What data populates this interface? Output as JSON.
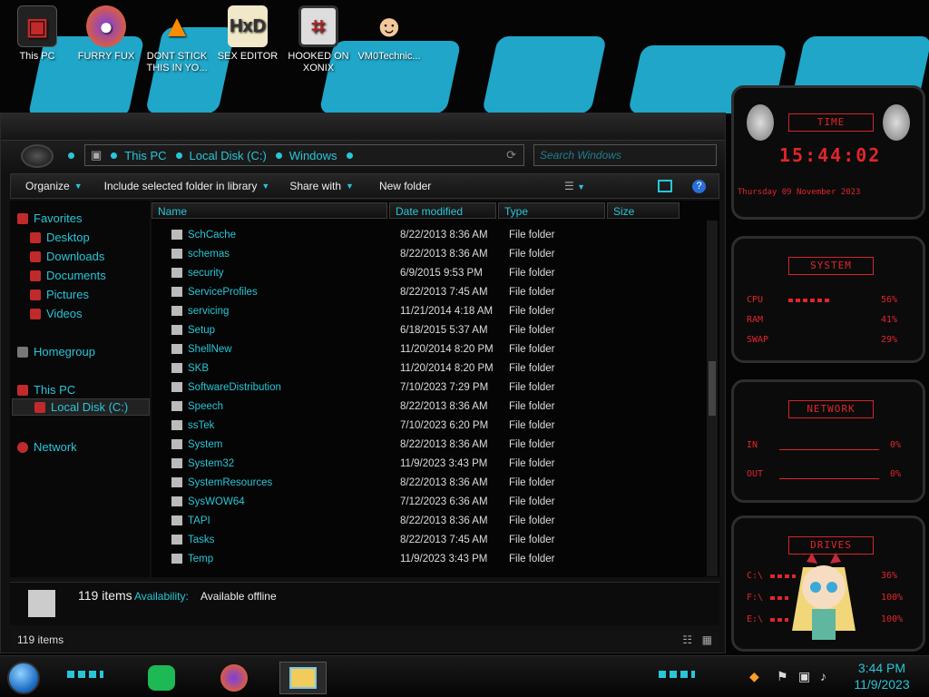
{
  "desktop": {
    "icons": [
      {
        "label": "This PC",
        "icon": "pc-icon"
      },
      {
        "label": "FURRY FUX",
        "icon": "firefox-icon"
      },
      {
        "label": "DONT STICK THIS IN YO...",
        "icon": "vlc-cone-icon"
      },
      {
        "label": "SEX EDITOR",
        "icon": "hxd-icon"
      },
      {
        "label": "HOOKED ON XONIX",
        "icon": "xonix-game-icon"
      },
      {
        "label": "VM0Technic...",
        "icon": "doctor-icon"
      }
    ]
  },
  "explorer": {
    "breadcrumb": [
      "This PC",
      "Local Disk (C:)",
      "Windows"
    ],
    "search_placeholder": "Search Windows",
    "toolbar": {
      "organize": "Organize",
      "include_library": "Include selected folder in library",
      "share_with": "Share with",
      "new_folder": "New folder"
    },
    "nav": {
      "favorites": "Favorites",
      "desktop": "Desktop",
      "downloads": "Downloads",
      "documents": "Documents",
      "pictures": "Pictures",
      "videos": "Videos",
      "homegroup": "Homegroup",
      "this_pc": "This PC",
      "local_disk": "Local Disk (C:)",
      "network": "Network"
    },
    "columns": {
      "name": "Name",
      "date": "Date modified",
      "type": "Type",
      "size": "Size"
    },
    "rows": [
      {
        "name": "SchCache",
        "date": "8/22/2013 8:36 AM",
        "type": "File folder"
      },
      {
        "name": "schemas",
        "date": "8/22/2013 8:36 AM",
        "type": "File folder"
      },
      {
        "name": "security",
        "date": "6/9/2015 9:53 PM",
        "type": "File folder"
      },
      {
        "name": "ServiceProfiles",
        "date": "8/22/2013 7:45 AM",
        "type": "File folder"
      },
      {
        "name": "servicing",
        "date": "11/21/2014 4:18 AM",
        "type": "File folder"
      },
      {
        "name": "Setup",
        "date": "6/18/2015 5:37 AM",
        "type": "File folder"
      },
      {
        "name": "ShellNew",
        "date": "11/20/2014 8:20 PM",
        "type": "File folder"
      },
      {
        "name": "SKB",
        "date": "11/20/2014 8:20 PM",
        "type": "File folder"
      },
      {
        "name": "SoftwareDistribution",
        "date": "7/10/2023 7:29 PM",
        "type": "File folder"
      },
      {
        "name": "Speech",
        "date": "8/22/2013 8:36 AM",
        "type": "File folder"
      },
      {
        "name": "ssTek",
        "date": "7/10/2023 6:20 PM",
        "type": "File folder"
      },
      {
        "name": "System",
        "date": "8/22/2013 8:36 AM",
        "type": "File folder"
      },
      {
        "name": "System32",
        "date": "11/9/2023 3:43 PM",
        "type": "File folder"
      },
      {
        "name": "SystemResources",
        "date": "8/22/2013 8:36 AM",
        "type": "File folder"
      },
      {
        "name": "SysWOW64",
        "date": "7/12/2023 6:36 AM",
        "type": "File folder"
      },
      {
        "name": "TAPI",
        "date": "8/22/2013 8:36 AM",
        "type": "File folder"
      },
      {
        "name": "Tasks",
        "date": "8/22/2013 7:45 AM",
        "type": "File folder"
      },
      {
        "name": "Temp",
        "date": "11/9/2023 3:43 PM",
        "type": "File folder"
      }
    ],
    "details": {
      "count": "119 items",
      "availability_label": "Availability:",
      "availability_value": "Available offline"
    },
    "status": "119 items"
  },
  "gadgets": {
    "time": {
      "title": "TIME",
      "clock": "15:44:02",
      "date": "Thursday 09 November 2023"
    },
    "system": {
      "title": "SYSTEM",
      "cpu": "CPU",
      "cpu_val": "56%",
      "ram": "RAM",
      "ram_val": "41%",
      "swap": "SWAP",
      "swap_val": "29%"
    },
    "network": {
      "title": "NETWORK",
      "in": "IN",
      "in_val": "0%",
      "out": "OUT",
      "out_val": "0%"
    },
    "drives": {
      "title": "DRIVES",
      "c": "C:\\",
      "c_val": "36%",
      "f": "F:\\",
      "f_val": "100%",
      "e": "E:\\",
      "e_val": "100%"
    }
  },
  "taskbar": {
    "time": "3:44 PM",
    "date": "11/9/2023"
  },
  "colors": {
    "accent": "#28c6d8",
    "gadget_red": "#e0262a"
  }
}
